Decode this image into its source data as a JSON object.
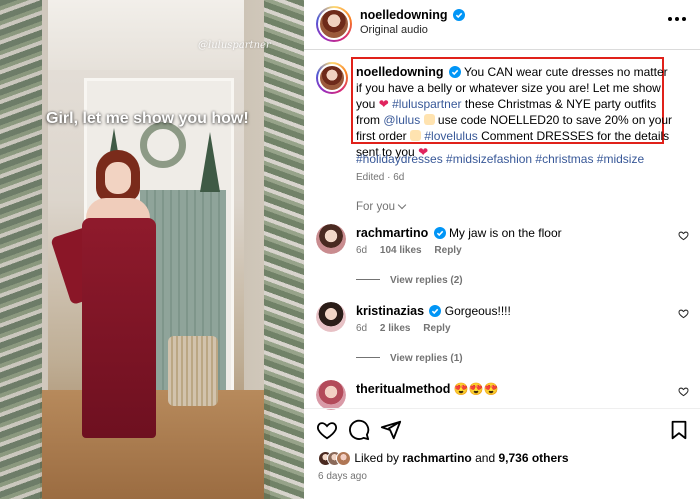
{
  "media": {
    "caption_overlay": "Girl, let me show you how!",
    "watermark": "@luluspartner"
  },
  "post_header": {
    "username": "noelledowning",
    "audio": "Original audio",
    "more_icon": "more-horizontal-icon"
  },
  "caption": {
    "username": "noelledowning",
    "part1": "You CAN wear cute dresses no matter if you have a belly or whatever size you are! Let me show you",
    "heart1": "❤",
    "mention1": "#luluspartner",
    "part2": "these Christmas & NYE party outfits from",
    "mention2": "@lulus",
    "part3": "use code NOELLED20 to save 20% on your first order",
    "mention3": "#lovelulus",
    "part4": "Comment DRESSES for the details sent to you",
    "heart2": "❤",
    "hashtags": "#holidaydresses #midsizefashion #christmas #midsize",
    "edited": "Edited · 6d"
  },
  "for_you": "For you",
  "comments": [
    {
      "username": "rachmartino",
      "verified": true,
      "text": "My jaw is on the floor",
      "age": "6d",
      "likes": "104 likes",
      "reply": "Reply",
      "view_replies": "View replies (2)"
    },
    {
      "username": "kristinazias",
      "verified": true,
      "text": "Gorgeous!!!!",
      "age": "6d",
      "likes": "2 likes",
      "reply": "Reply",
      "view_replies": "View replies (1)"
    },
    {
      "username": "theritualmethod",
      "verified": false,
      "text": "😍😍😍"
    }
  ],
  "actions": {
    "like": "heart-outline-icon",
    "comment": "comment-bubble-icon",
    "share": "paper-plane-icon",
    "save": "bookmark-icon"
  },
  "likes": {
    "prefix": "Liked by",
    "user": "rachmartino",
    "and": "and",
    "others": "9,736 others"
  },
  "date": "6 days ago",
  "colors": {
    "highlight_box": "#e0211a",
    "link": "#385898",
    "verified": "#0095f6",
    "heart": "#e0245e"
  }
}
